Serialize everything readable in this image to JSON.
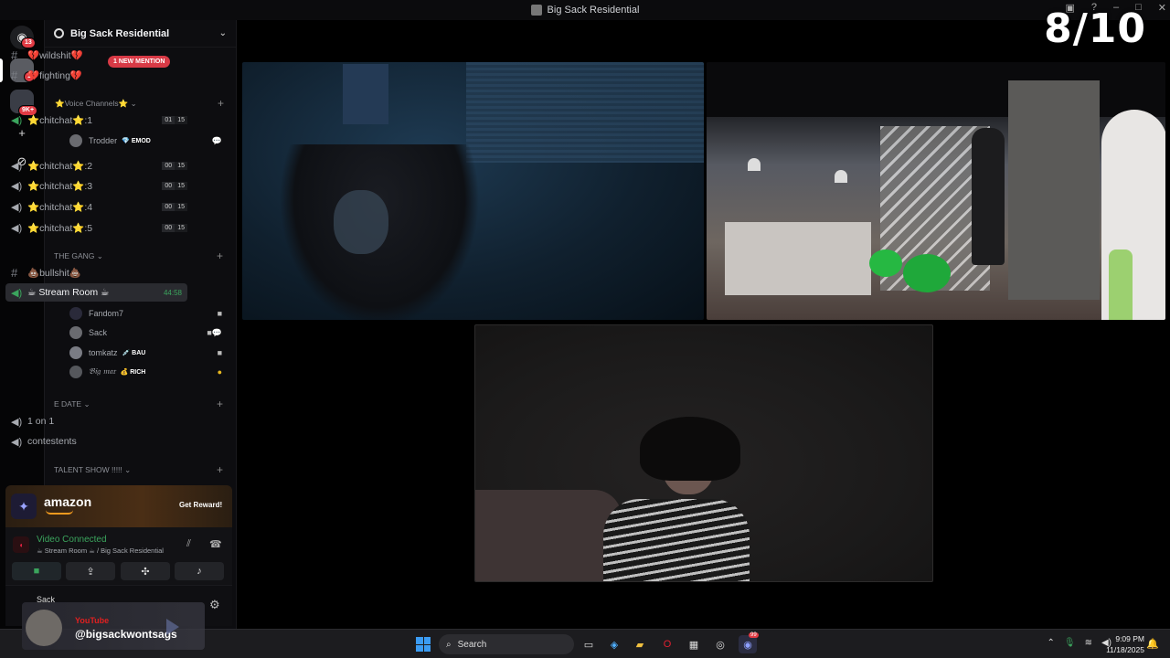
{
  "window": {
    "title": "Big Sack Residential",
    "score_overlay": "8/10"
  },
  "rail": {
    "badges": [
      "13",
      "1",
      "9K+"
    ]
  },
  "sidebar": {
    "server_name": "Big Sack Residential",
    "text_channels_top": [
      {
        "label": "💔wildshit💔"
      },
      {
        "label": "💔fighting💔"
      }
    ],
    "mention_pill": "1 NEW MENTION",
    "voice_category": "⭐Voice Channels⭐",
    "voice_channels": [
      {
        "label": "⭐chitchat⭐:1",
        "count_a": "01",
        "count_b": "15"
      },
      {
        "label": "⭐chitchat⭐:2",
        "count_a": "00",
        "count_b": "15"
      },
      {
        "label": "⭐chitchat⭐:3",
        "count_a": "00",
        "count_b": "15"
      },
      {
        "label": "⭐chitchat⭐:4",
        "count_a": "00",
        "count_b": "15"
      },
      {
        "label": "⭐chitchat⭐:5",
        "count_a": "00",
        "count_b": "15"
      }
    ],
    "voice_user_1": {
      "name": "Trodder",
      "tag": "💎 EMOD"
    },
    "gang_category": "THE GANG",
    "bullshit_channel": "💩bullshit💩",
    "stream_room": {
      "label": "☕ Stream Room ☕",
      "time": "44:58"
    },
    "stream_users": [
      {
        "name": "Fandom7",
        "tag": ""
      },
      {
        "name": "Sack",
        "tag": ""
      },
      {
        "name": "tomkatz",
        "tag": "💉 BAU"
      },
      {
        "name": "𝔅𝔦𝔤 𝔪𝔞𝔯",
        "tag": "💰 RICH"
      }
    ],
    "edate_category": "E DATE",
    "edate_channels": [
      {
        "label": "1 on 1"
      },
      {
        "label": "contestents"
      }
    ],
    "talent_category": "TALENT SHOW !!!!!"
  },
  "promo": {
    "brand": "amazon",
    "cta": "Get Reward!"
  },
  "voice_panel": {
    "status": "Video Connected",
    "sub": "☕ Stream Room ☕ / Big Sack Residential"
  },
  "user_bar": {
    "name": "Sack"
  },
  "youtube_overlay": {
    "label": "YouTube",
    "handle": "@bigsackwontsags"
  },
  "taskbar": {
    "search_placeholder": "Search",
    "time": "9:09 PM",
    "date": "11/18/2025",
    "discord_badge": "99"
  },
  "colors": {
    "accent_green": "#3ba55d",
    "mention_red": "#d83a46",
    "win_blue": "#3b9cf4"
  }
}
